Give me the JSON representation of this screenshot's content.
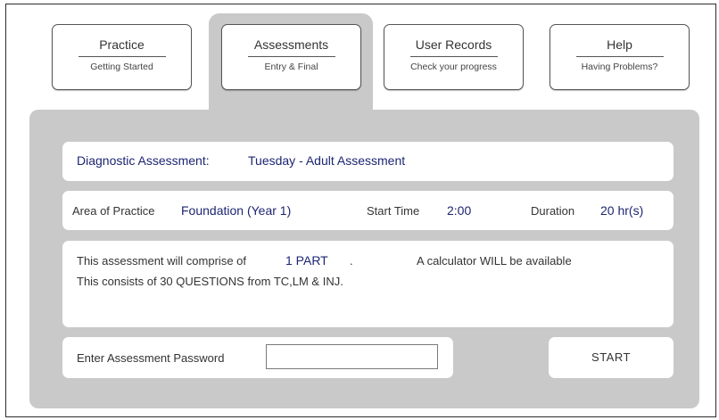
{
  "tabs": [
    {
      "title": "Practice",
      "subtitle": "Getting Started"
    },
    {
      "title": "Assessments",
      "subtitle": "Entry & Final"
    },
    {
      "title": "User Records",
      "subtitle": "Check your progress"
    },
    {
      "title": "Help",
      "subtitle": "Having Problems?"
    }
  ],
  "assessment": {
    "label": "Diagnostic Assessment:",
    "name": "Tuesday - Adult Assessment"
  },
  "details": {
    "area_label": "Area of Practice",
    "area_value": "Foundation (Year 1)",
    "start_label": "Start Time",
    "start_value": "2:00",
    "duration_label": "Duration",
    "duration_value": "20 hr(s)"
  },
  "info": {
    "comprise_text": "This assessment will comprise of",
    "parts_value": "1 PART",
    "dot": ".",
    "calculator_text": "A calculator WILL be available",
    "questions_text": "This consists of 30 QUESTIONS from TC,LM & INJ."
  },
  "password": {
    "label": "Enter Assessment Password",
    "value": ""
  },
  "start_button": "START",
  "colors": {
    "panel": "#c9c9c9",
    "accent_text": "#1d2572"
  }
}
